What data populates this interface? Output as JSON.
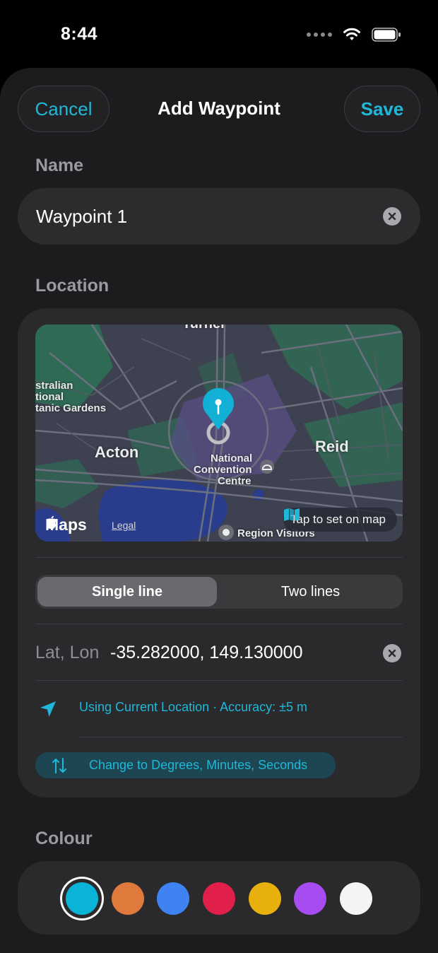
{
  "status_bar": {
    "time": "8:44"
  },
  "header": {
    "cancel_label": "Cancel",
    "title": "Add Waypoint",
    "save_label": "Save"
  },
  "name_section": {
    "label": "Name",
    "value": "Waypoint 1"
  },
  "location_section": {
    "label": "Location",
    "map": {
      "labels": {
        "turner": "Turner",
        "gardens_1": "stralian",
        "gardens_2": "tional",
        "gardens_3": "tanic Gardens",
        "acton": "Acton",
        "reid": "Reid",
        "ncc_1": "National",
        "ncc_2": "Convention",
        "ncc_3": "Centre",
        "visitors": "Region Visitors"
      },
      "logo": "Maps",
      "legal": "Legal",
      "tap_label": "Tap to set on map"
    },
    "format_options": [
      "Single line",
      "Two lines"
    ],
    "selected_format": "Single line",
    "coord_label": "Lat, Lon",
    "coord_value": "-35.282000, 149.130000",
    "current_location": "Using Current Location · Accuracy: ±5 m",
    "dms_button": "Change to Degrees, Minutes, Seconds"
  },
  "colour_section": {
    "label": "Colour",
    "swatches": [
      "#0ab4d6",
      "#e07a3c",
      "#3f82f2",
      "#e0204a",
      "#e8b00c",
      "#a64cf0",
      "#f4f4f6"
    ],
    "selected_index": 0
  },
  "colors": {
    "accent": "#1fb8d8",
    "sheet_bg": "#1c1c1e",
    "card_bg": "#2a2a2c"
  }
}
